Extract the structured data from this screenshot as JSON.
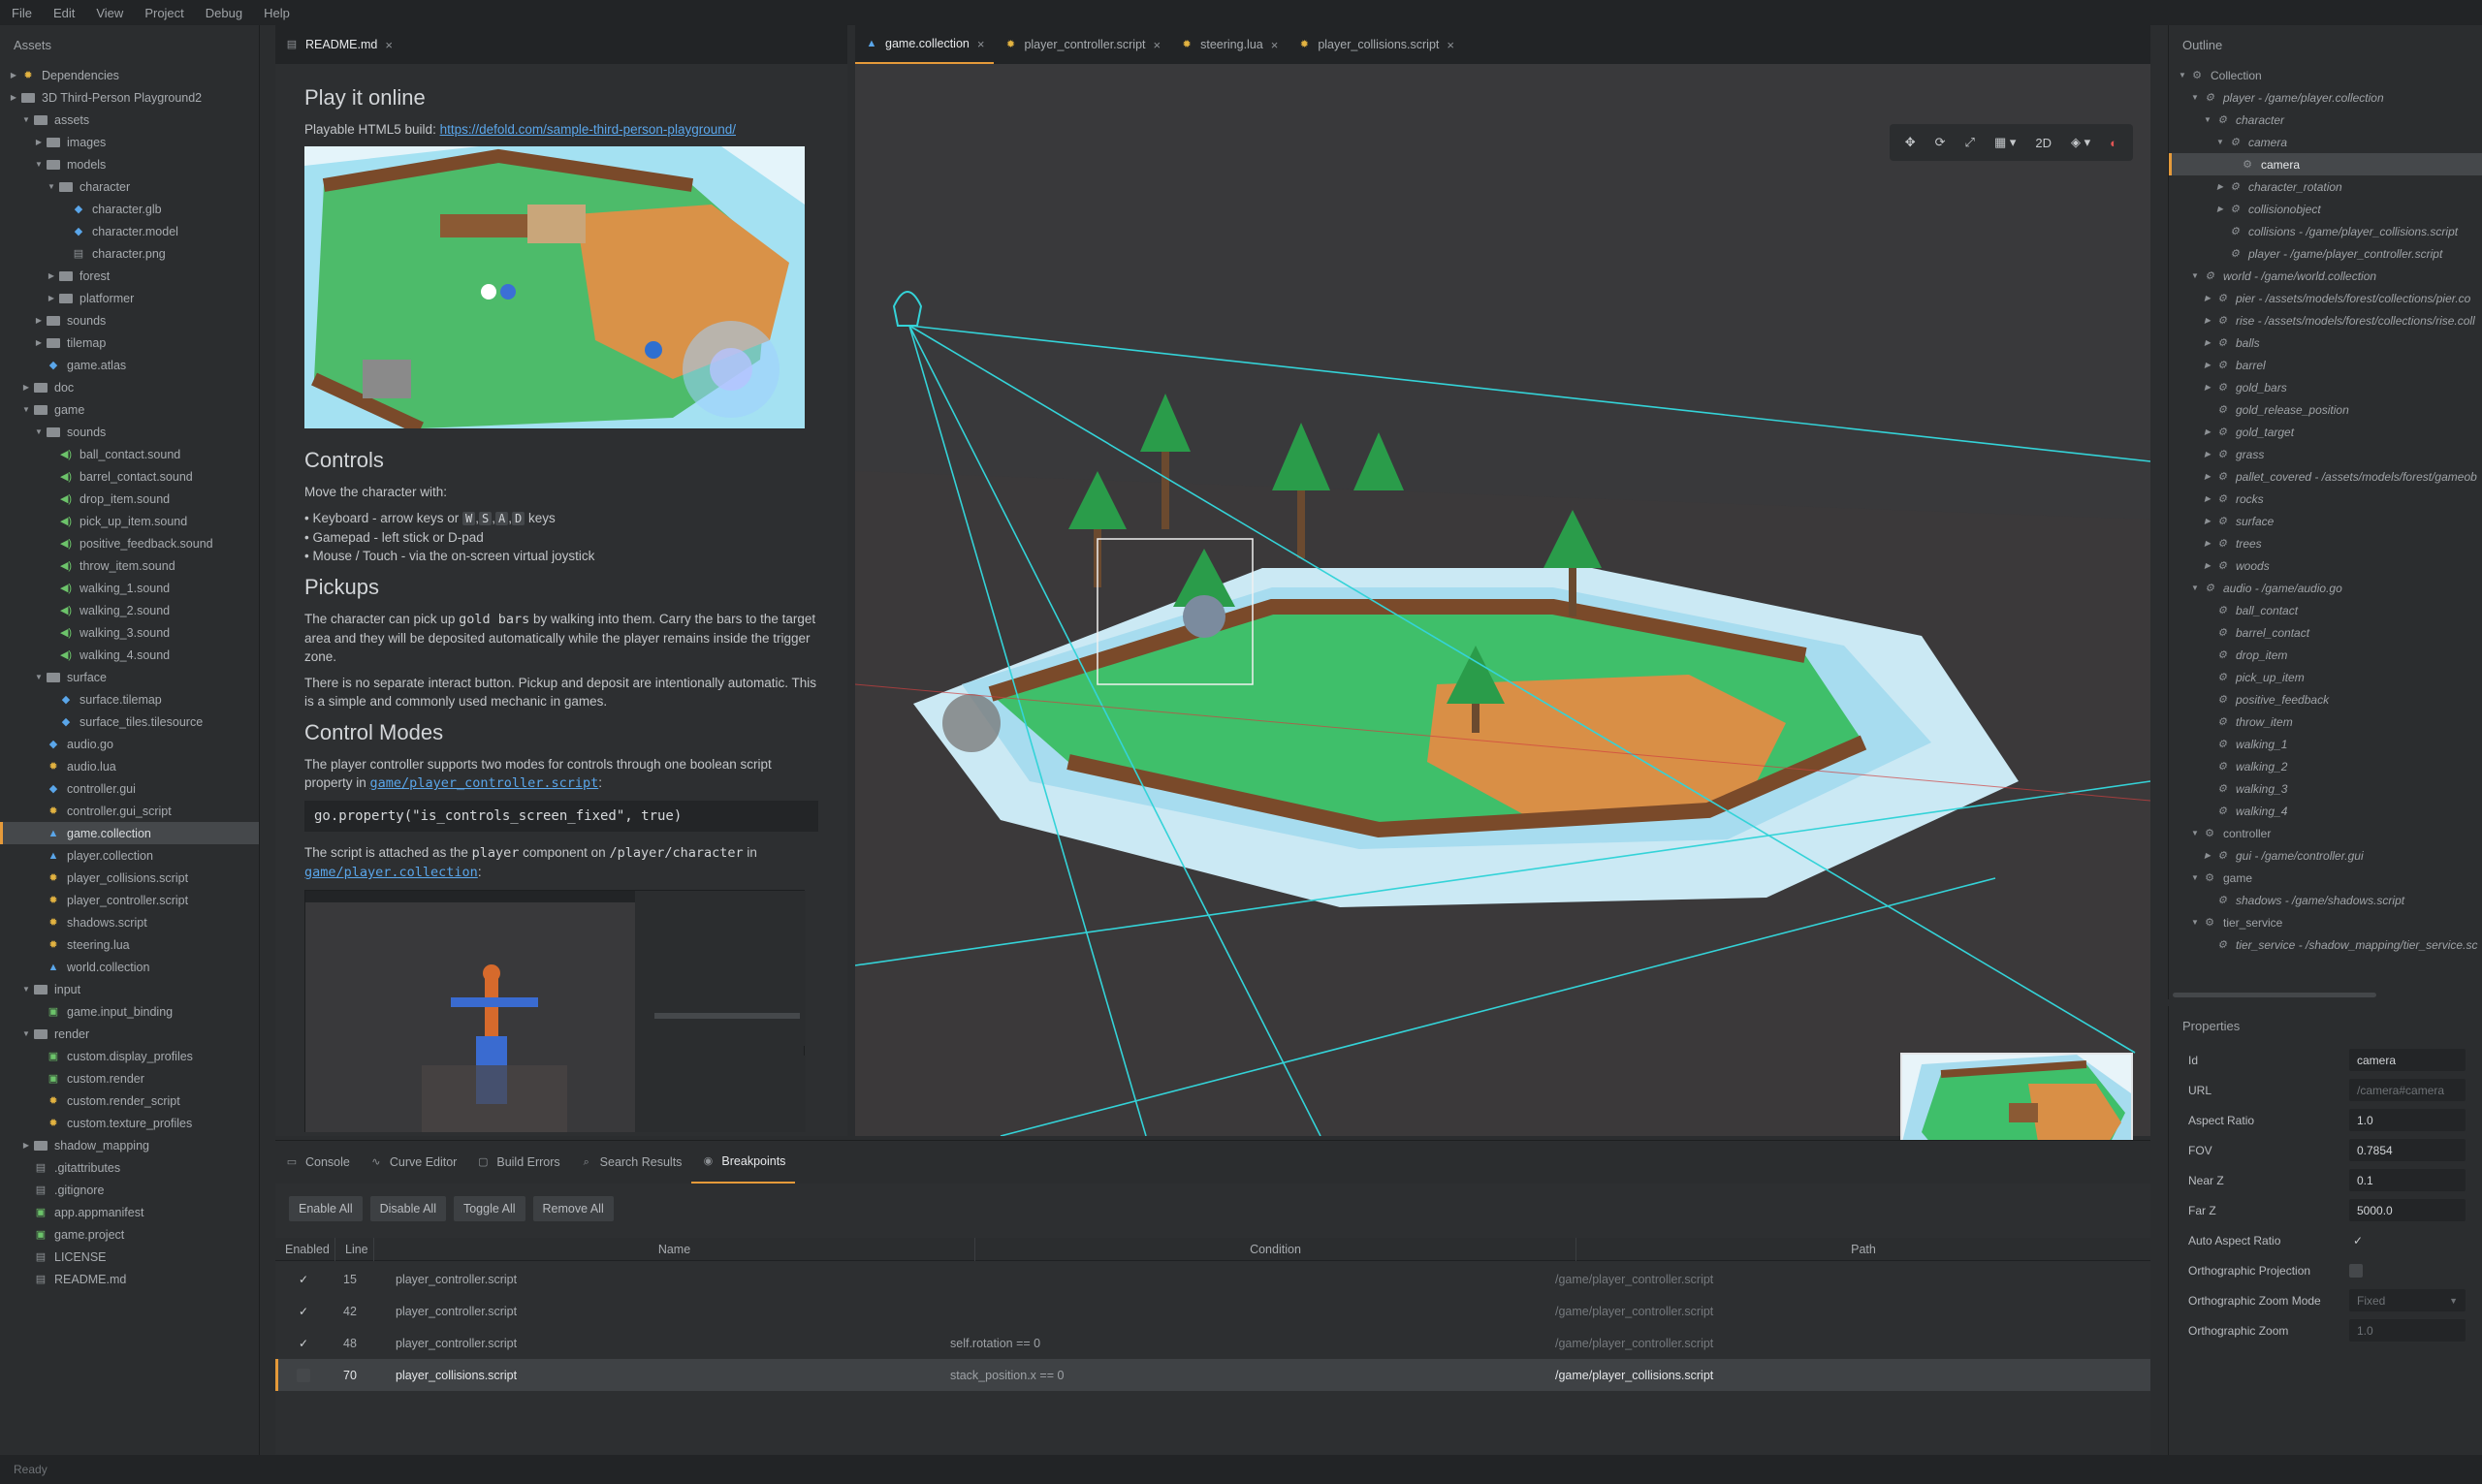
{
  "menu": [
    "File",
    "Edit",
    "View",
    "Project",
    "Debug",
    "Help"
  ],
  "assets": {
    "title": "Assets",
    "items": [
      {
        "label": "Dependencies",
        "depth": 0,
        "caret": "right",
        "icon": "gear"
      },
      {
        "label": "3D Third-Person Playground2",
        "depth": 0,
        "caret": "right",
        "icon": "folder"
      },
      {
        "label": "assets",
        "depth": 1,
        "caret": "down",
        "icon": "folder"
      },
      {
        "label": "images",
        "depth": 2,
        "caret": "right",
        "icon": "folder"
      },
      {
        "label": "models",
        "depth": 2,
        "caret": "down",
        "icon": "folder"
      },
      {
        "label": "character",
        "depth": 3,
        "caret": "down",
        "icon": "folder"
      },
      {
        "label": "character.glb",
        "depth": 4,
        "caret": "",
        "icon": "blue"
      },
      {
        "label": "character.model",
        "depth": 4,
        "caret": "",
        "icon": "blue"
      },
      {
        "label": "character.png",
        "depth": 4,
        "caret": "",
        "icon": "gray"
      },
      {
        "label": "forest",
        "depth": 3,
        "caret": "right",
        "icon": "folder"
      },
      {
        "label": "platformer",
        "depth": 3,
        "caret": "right",
        "icon": "folder"
      },
      {
        "label": "sounds",
        "depth": 2,
        "caret": "right",
        "icon": "folder"
      },
      {
        "label": "tilemap",
        "depth": 2,
        "caret": "right",
        "icon": "folder"
      },
      {
        "label": "game.atlas",
        "depth": 2,
        "caret": "",
        "icon": "blue"
      },
      {
        "label": "doc",
        "depth": 1,
        "caret": "right",
        "icon": "folder"
      },
      {
        "label": "game",
        "depth": 1,
        "caret": "down",
        "icon": "folder"
      },
      {
        "label": "sounds",
        "depth": 2,
        "caret": "down",
        "icon": "folder"
      },
      {
        "label": "ball_contact.sound",
        "depth": 3,
        "caret": "",
        "icon": "sound"
      },
      {
        "label": "barrel_contact.sound",
        "depth": 3,
        "caret": "",
        "icon": "sound"
      },
      {
        "label": "drop_item.sound",
        "depth": 3,
        "caret": "",
        "icon": "sound"
      },
      {
        "label": "pick_up_item.sound",
        "depth": 3,
        "caret": "",
        "icon": "sound"
      },
      {
        "label": "positive_feedback.sound",
        "depth": 3,
        "caret": "",
        "icon": "sound"
      },
      {
        "label": "throw_item.sound",
        "depth": 3,
        "caret": "",
        "icon": "sound"
      },
      {
        "label": "walking_1.sound",
        "depth": 3,
        "caret": "",
        "icon": "sound"
      },
      {
        "label": "walking_2.sound",
        "depth": 3,
        "caret": "",
        "icon": "sound"
      },
      {
        "label": "walking_3.sound",
        "depth": 3,
        "caret": "",
        "icon": "sound"
      },
      {
        "label": "walking_4.sound",
        "depth": 3,
        "caret": "",
        "icon": "sound"
      },
      {
        "label": "surface",
        "depth": 2,
        "caret": "down",
        "icon": "folder"
      },
      {
        "label": "surface.tilemap",
        "depth": 3,
        "caret": "",
        "icon": "blue"
      },
      {
        "label": "surface_tiles.tilesource",
        "depth": 3,
        "caret": "",
        "icon": "blue"
      },
      {
        "label": "audio.go",
        "depth": 2,
        "caret": "",
        "icon": "blue"
      },
      {
        "label": "audio.lua",
        "depth": 2,
        "caret": "",
        "icon": "gear"
      },
      {
        "label": "controller.gui",
        "depth": 2,
        "caret": "",
        "icon": "blue"
      },
      {
        "label": "controller.gui_script",
        "depth": 2,
        "caret": "",
        "icon": "gear"
      },
      {
        "label": "game.collection",
        "depth": 2,
        "caret": "",
        "icon": "collection",
        "selected": true
      },
      {
        "label": "player.collection",
        "depth": 2,
        "caret": "",
        "icon": "collection"
      },
      {
        "label": "player_collisions.script",
        "depth": 2,
        "caret": "",
        "icon": "gear"
      },
      {
        "label": "player_controller.script",
        "depth": 2,
        "caret": "",
        "icon": "gear"
      },
      {
        "label": "shadows.script",
        "depth": 2,
        "caret": "",
        "icon": "gear"
      },
      {
        "label": "steering.lua",
        "depth": 2,
        "caret": "",
        "icon": "gear"
      },
      {
        "label": "world.collection",
        "depth": 2,
        "caret": "",
        "icon": "collection"
      },
      {
        "label": "input",
        "depth": 1,
        "caret": "down",
        "icon": "folder"
      },
      {
        "label": "game.input_binding",
        "depth": 2,
        "caret": "",
        "icon": "green"
      },
      {
        "label": "render",
        "depth": 1,
        "caret": "down",
        "icon": "folder"
      },
      {
        "label": "custom.display_profiles",
        "depth": 2,
        "caret": "",
        "icon": "green"
      },
      {
        "label": "custom.render",
        "depth": 2,
        "caret": "",
        "icon": "green"
      },
      {
        "label": "custom.render_script",
        "depth": 2,
        "caret": "",
        "icon": "gear"
      },
      {
        "label": "custom.texture_profiles",
        "depth": 2,
        "caret": "",
        "icon": "gear"
      },
      {
        "label": "shadow_mapping",
        "depth": 1,
        "caret": "right",
        "icon": "folder"
      },
      {
        "label": ".gitattributes",
        "depth": 1,
        "caret": "",
        "icon": "gray"
      },
      {
        "label": ".gitignore",
        "depth": 1,
        "caret": "",
        "icon": "gray"
      },
      {
        "label": "app.appmanifest",
        "depth": 1,
        "caret": "",
        "icon": "green"
      },
      {
        "label": "game.project",
        "depth": 1,
        "caret": "",
        "icon": "green"
      },
      {
        "label": "LICENSE",
        "depth": 1,
        "caret": "",
        "icon": "gray"
      },
      {
        "label": "README.md",
        "depth": 1,
        "caret": "",
        "icon": "gray"
      }
    ]
  },
  "readme": {
    "tab": "README.md",
    "h_play": "Play it online",
    "build_label": "Playable HTML5 build: ",
    "build_link": "https://defold.com/sample-third-person-playground/",
    "h_controls": "Controls",
    "move_text": "Move the character with:",
    "list1_a": "Keyboard - arrow keys or ",
    "key_w": "W",
    "key_s": "S",
    "key_a": "A",
    "key_d": "D",
    "list1_b": " keys",
    "list2": "Gamepad - left stick or D-pad",
    "list3": "Mouse / Touch - via the on-screen virtual joystick",
    "h_pickups": "Pickups",
    "pick_a": "The character can pick up ",
    "pick_code": "gold bars",
    "pick_b": " by walking into them. Carry the bars to the target area and they will be deposited automatically while the player remains inside the trigger zone.",
    "pick2": "There is no separate interact button. Pickup and deposit are intentionally automatic. This is a simple and commonly used mechanic in games.",
    "h_modes": "Control Modes",
    "modes_a": "The player controller supports two modes for controls through one boolean script property in ",
    "modes_link": "game/player_controller.script",
    "modes_b": ":",
    "code": "go.property(\"is_controls_screen_fixed\", true)",
    "attach_a": "The script is attached as the ",
    "attach_code1": "player",
    "attach_b": " component on ",
    "attach_code2": "/player/character",
    "attach_c": " in",
    "attach_link": "game/player.collection",
    "attach_d": ":"
  },
  "viewport": {
    "tabs": [
      {
        "label": "game.collection",
        "active": true,
        "icon": "collection"
      },
      {
        "label": "player_controller.script",
        "active": false,
        "icon": "gear"
      },
      {
        "label": "steering.lua",
        "active": false,
        "icon": "gear"
      },
      {
        "label": "player_collisions.script",
        "active": false,
        "icon": "gear"
      }
    ],
    "mode_2d": "2D"
  },
  "outline": {
    "title": "Outline",
    "items": [
      {
        "label": "Collection",
        "depth": 0,
        "caret": "down",
        "italic": false
      },
      {
        "label": "player - /game/player.collection",
        "depth": 1,
        "caret": "down",
        "italic": true
      },
      {
        "label": "character",
        "depth": 2,
        "caret": "down",
        "italic": true
      },
      {
        "label": "camera",
        "depth": 3,
        "caret": "down",
        "italic": true
      },
      {
        "label": "camera",
        "depth": 4,
        "caret": "",
        "italic": false,
        "selected": true
      },
      {
        "label": "character_rotation",
        "depth": 3,
        "caret": "right",
        "italic": true
      },
      {
        "label": "collisionobject",
        "depth": 3,
        "caret": "right",
        "italic": true
      },
      {
        "label": "collisions - /game/player_collisions.script",
        "depth": 3,
        "caret": "",
        "italic": true
      },
      {
        "label": "player - /game/player_controller.script",
        "depth": 3,
        "caret": "",
        "italic": true
      },
      {
        "label": "world - /game/world.collection",
        "depth": 1,
        "caret": "down",
        "italic": true
      },
      {
        "label": "pier - /assets/models/forest/collections/pier.co",
        "depth": 2,
        "caret": "right",
        "italic": true
      },
      {
        "label": "rise - /assets/models/forest/collections/rise.coll",
        "depth": 2,
        "caret": "right",
        "italic": true
      },
      {
        "label": "balls",
        "depth": 2,
        "caret": "right",
        "italic": true
      },
      {
        "label": "barrel",
        "depth": 2,
        "caret": "right",
        "italic": true
      },
      {
        "label": "gold_bars",
        "depth": 2,
        "caret": "right",
        "italic": true
      },
      {
        "label": "gold_release_position",
        "depth": 2,
        "caret": "",
        "italic": true
      },
      {
        "label": "gold_target",
        "depth": 2,
        "caret": "right",
        "italic": true
      },
      {
        "label": "grass",
        "depth": 2,
        "caret": "right",
        "italic": true
      },
      {
        "label": "pallet_covered - /assets/models/forest/gameob",
        "depth": 2,
        "caret": "right",
        "italic": true
      },
      {
        "label": "rocks",
        "depth": 2,
        "caret": "right",
        "italic": true
      },
      {
        "label": "surface",
        "depth": 2,
        "caret": "right",
        "italic": true
      },
      {
        "label": "trees",
        "depth": 2,
        "caret": "right",
        "italic": true
      },
      {
        "label": "woods",
        "depth": 2,
        "caret": "right",
        "italic": true
      },
      {
        "label": "audio - /game/audio.go",
        "depth": 1,
        "caret": "down",
        "italic": true
      },
      {
        "label": "ball_contact",
        "depth": 2,
        "caret": "",
        "italic": true
      },
      {
        "label": "barrel_contact",
        "depth": 2,
        "caret": "",
        "italic": true
      },
      {
        "label": "drop_item",
        "depth": 2,
        "caret": "",
        "italic": true
      },
      {
        "label": "pick_up_item",
        "depth": 2,
        "caret": "",
        "italic": true
      },
      {
        "label": "positive_feedback",
        "depth": 2,
        "caret": "",
        "italic": true
      },
      {
        "label": "throw_item",
        "depth": 2,
        "caret": "",
        "italic": true
      },
      {
        "label": "walking_1",
        "depth": 2,
        "caret": "",
        "italic": true
      },
      {
        "label": "walking_2",
        "depth": 2,
        "caret": "",
        "italic": true
      },
      {
        "label": "walking_3",
        "depth": 2,
        "caret": "",
        "italic": true
      },
      {
        "label": "walking_4",
        "depth": 2,
        "caret": "",
        "italic": true
      },
      {
        "label": "controller",
        "depth": 1,
        "caret": "down",
        "italic": false
      },
      {
        "label": "gui - /game/controller.gui",
        "depth": 2,
        "caret": "right",
        "italic": true
      },
      {
        "label": "game",
        "depth": 1,
        "caret": "down",
        "italic": false
      },
      {
        "label": "shadows - /game/shadows.script",
        "depth": 2,
        "caret": "",
        "italic": true
      },
      {
        "label": "tier_service",
        "depth": 1,
        "caret": "down",
        "italic": false
      },
      {
        "label": "tier_service - /shadow_mapping/tier_service.sc",
        "depth": 2,
        "caret": "",
        "italic": true
      }
    ]
  },
  "properties": {
    "title": "Properties",
    "rows": [
      {
        "label": "Id",
        "value": "camera",
        "dim": false
      },
      {
        "label": "URL",
        "value": "/camera#camera",
        "dim": true
      },
      {
        "label": "Aspect Ratio",
        "value": "1.0",
        "dim": false
      },
      {
        "label": "FOV",
        "value": "0.7854",
        "dim": false
      },
      {
        "label": "Near Z",
        "value": "0.1",
        "dim": false
      },
      {
        "label": "Far Z",
        "value": "5000.0",
        "dim": false
      }
    ],
    "auto_aspect": "Auto Aspect Ratio",
    "ortho_proj": "Orthographic Projection",
    "ortho_zoom_mode": "Orthographic Zoom Mode",
    "ortho_zoom_mode_value": "Fixed",
    "ortho_zoom": "Orthographic Zoom",
    "ortho_zoom_value": "1.0"
  },
  "bottom": {
    "tabs": [
      "Console",
      "Curve Editor",
      "Build Errors",
      "Search Results",
      "Breakpoints"
    ],
    "buttons": [
      "Enable All",
      "Disable All",
      "Toggle All",
      "Remove All"
    ],
    "columns": [
      "Enabled",
      "Line",
      "Name",
      "Condition",
      "Path"
    ],
    "rows": [
      {
        "enabled": true,
        "line": "15",
        "name": "player_controller.script",
        "condition": "",
        "path": "/game/player_controller.script"
      },
      {
        "enabled": true,
        "line": "42",
        "name": "player_controller.script",
        "condition": "",
        "path": "/game/player_controller.script"
      },
      {
        "enabled": true,
        "line": "48",
        "name": "player_controller.script",
        "condition": "self.rotation == 0",
        "path": "/game/player_controller.script"
      },
      {
        "enabled": false,
        "line": "70",
        "name": "player_collisions.script",
        "condition": "stack_position.x == 0",
        "path": "/game/player_collisions.script",
        "selected": true
      }
    ]
  },
  "status": "Ready",
  "colors": {
    "accent": "#e59a3a",
    "link": "#5aa6ea",
    "grass": "#3fbf6a",
    "sand": "#d98f46",
    "water": "#cbe9f4"
  }
}
